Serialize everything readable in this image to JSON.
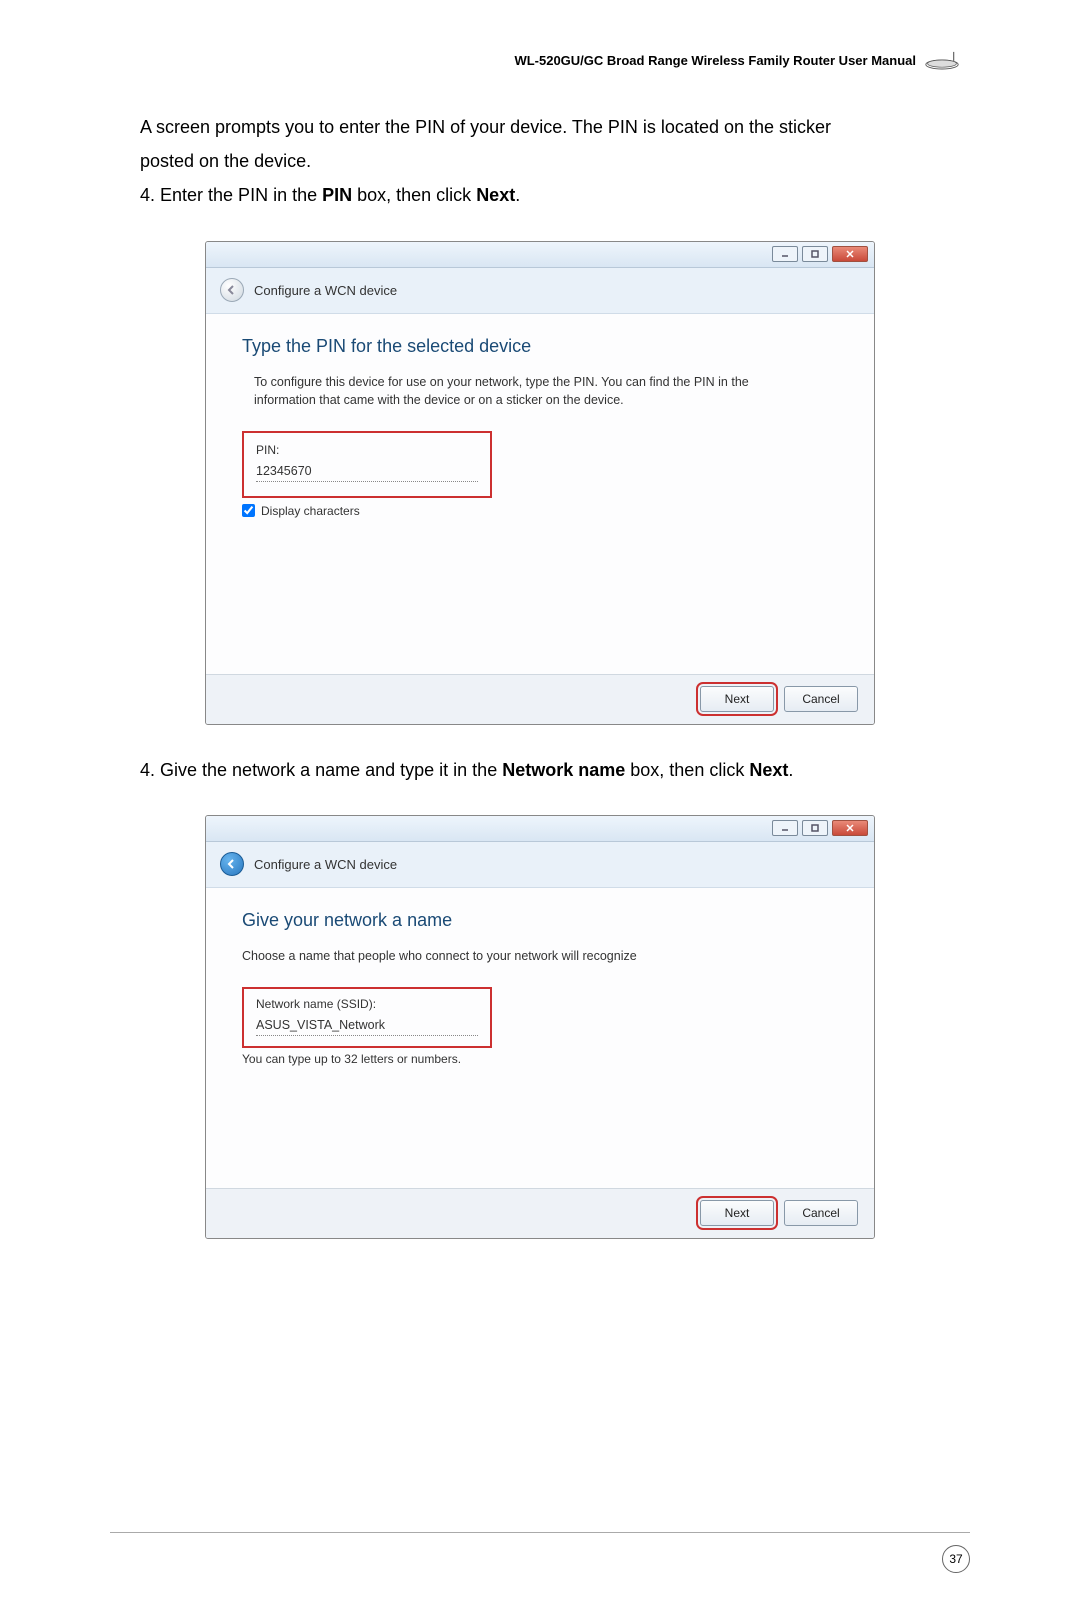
{
  "header": {
    "manual_title": "WL-520GU/GC Broad Range Wireless Family Router User Manual"
  },
  "intro": {
    "line1": "A screen prompts you to enter the PIN of your device. The PIN is located on the sticker",
    "line2": "posted on the device.",
    "step4a": "4. Enter the PIN   in the ",
    "step4b_bold": "PIN",
    "step4c": " box, then click ",
    "step4d_bold": "Next",
    "step4e": "."
  },
  "dialog1": {
    "wizard_title": "Configure a WCN device",
    "heading": "Type the PIN for the selected device",
    "desc": "To configure this device for use on your network, type the PIN. You can find the PIN in the information that came with the device or on a sticker on the device.",
    "pin_label": "PIN:",
    "pin_value": "12345670",
    "display_chars_label": "Display characters",
    "next_btn": "Next",
    "cancel_btn": "Cancel"
  },
  "mid_text": {
    "a": "4. Give the network a name and type it in the ",
    "b_bold": "Network name",
    "c": " box, then click ",
    "d_bold": "Next",
    "e": "."
  },
  "dialog2": {
    "wizard_title": "Configure a WCN device",
    "heading": "Give your network a name",
    "desc": "Choose a name that people who connect to your network will recognize",
    "ssid_label": "Network name (SSID):",
    "ssid_value": "ASUS_VISTA_Network",
    "hint": "You can type up to 32 letters or numbers.",
    "next_btn": "Next",
    "cancel_btn": "Cancel"
  },
  "page_number": "37"
}
